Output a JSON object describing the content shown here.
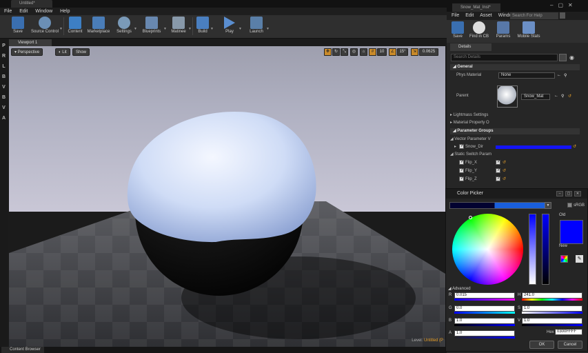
{
  "editor": {
    "tab_title": "Untitled*",
    "menu": [
      "File",
      "Edit",
      "Window",
      "Help"
    ],
    "toolbar": [
      {
        "label": "Save",
        "icon": "save-icon",
        "color": "#3a6fb0"
      },
      {
        "label": "Source Control",
        "icon": "source-control-icon",
        "color": "#6b8fb5"
      },
      {
        "label": "Content",
        "icon": "content-icon",
        "color": "#3d7fc4"
      },
      {
        "label": "Marketplace",
        "icon": "marketplace-icon",
        "color": "#4a7db8"
      },
      {
        "label": "Settings",
        "icon": "settings-icon",
        "color": "#7a9ab8"
      },
      {
        "label": "Blueprints",
        "icon": "blueprints-icon",
        "color": "#6888b0"
      },
      {
        "label": "Matinee",
        "icon": "matinee-icon",
        "color": "#8899aa"
      },
      {
        "label": "Build",
        "icon": "build-icon",
        "color": "#4a7fc0"
      },
      {
        "label": "Play",
        "icon": "play-icon",
        "color": "#5a8ed0"
      },
      {
        "label": "Launch",
        "icon": "launch-icon",
        "color": "#5a7fa8"
      }
    ],
    "modes": [
      "P",
      "R",
      "L",
      "B",
      "V",
      "B",
      "V",
      "A"
    ],
    "viewport": {
      "tab": "Viewport 1",
      "perspective": "Perspective",
      "lit": "Lit",
      "show": "Show",
      "grid_snap": "10",
      "rot_snap": "15°",
      "scale_snap": "0.0625",
      "level_label": "Level:",
      "level_name": "Untitled (P"
    },
    "content_browser": "Content Browser"
  },
  "material": {
    "tab_title": "Snow_Mat_Inst*",
    "menu": [
      "File",
      "Edit",
      "Asset",
      "Window"
    ],
    "search_help": "Search For Help",
    "toolbar": [
      {
        "label": "Save",
        "icon": "save-icon"
      },
      {
        "label": "Find in CB",
        "icon": "find-in-cb-icon"
      },
      {
        "label": "Params",
        "icon": "params-icon"
      },
      {
        "label": "Mobile Stats",
        "icon": "mobile-stats-icon"
      }
    ],
    "details_tab": "Details",
    "search_details": "Search Details",
    "general": "General",
    "phys_material_label": "Phys Material",
    "phys_material_value": "None",
    "parent_label": "Parent",
    "parent_value": "Snow_Mat",
    "lightmass": "Lightmass Settings",
    "material_property": "Material Property O",
    "param_groups": "Parameter Groups",
    "vector_params": "Vector Parameter V",
    "snow_dir": "Snow_Dir",
    "static_switch": "Static Switch Param",
    "flip_x": "Flip_X",
    "flip_y": "Flip_Y",
    "flip_z": "Flip_Z"
  },
  "color_picker": {
    "title": "Color Picker",
    "srgb": "sRGB",
    "old_label": "Old",
    "new_label": "New",
    "advanced": "Advanced",
    "R": "0.015",
    "G": "0.0",
    "B": "1.0",
    "A": "1.0",
    "H": "241.0",
    "S": "1.0",
    "V": "1.0",
    "hex_label": "Hex",
    "hex": "0300FFFF",
    "ok": "OK",
    "cancel": "Cancel",
    "current_color": "#0300ff"
  }
}
